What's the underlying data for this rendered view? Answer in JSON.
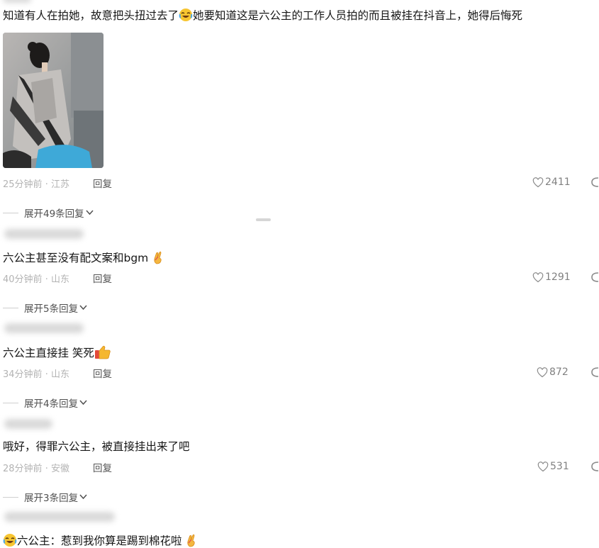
{
  "comments": [
    {
      "text": "知道有人在拍她，故意把头扭过去了",
      "text_after_emoji": "她要知道这是六公主的工作人员拍的而且被挂在抖音上，她得后悔死",
      "time": "25分钟前",
      "location": "江苏",
      "reply_label": "回复",
      "likes": "2411",
      "expand_label": "展开49条回复"
    },
    {
      "text": "六公主甚至没有配文案和bgm",
      "time": "40分钟前",
      "location": "山东",
      "reply_label": "回复",
      "likes": "1291",
      "expand_label": "展开5条回复"
    },
    {
      "text": "六公主直接挂 笑死",
      "time": "34分钟前",
      "location": "山东",
      "reply_label": "回复",
      "likes": "872",
      "expand_label": "展开4条回复"
    },
    {
      "text": "哦好，得罪六公主，被直接挂出来了吧",
      "time": "28分钟前",
      "location": "安徽",
      "reply_label": "回复",
      "likes": "531",
      "expand_label": "展开3条回复"
    },
    {
      "text": "六公主：惹到我你算是踢到棉花啦"
    }
  ],
  "meta_separator": "·",
  "colors": {
    "text": "#161616",
    "meta": "#b3b3b3",
    "heart_outline": "#8a8a8a"
  }
}
